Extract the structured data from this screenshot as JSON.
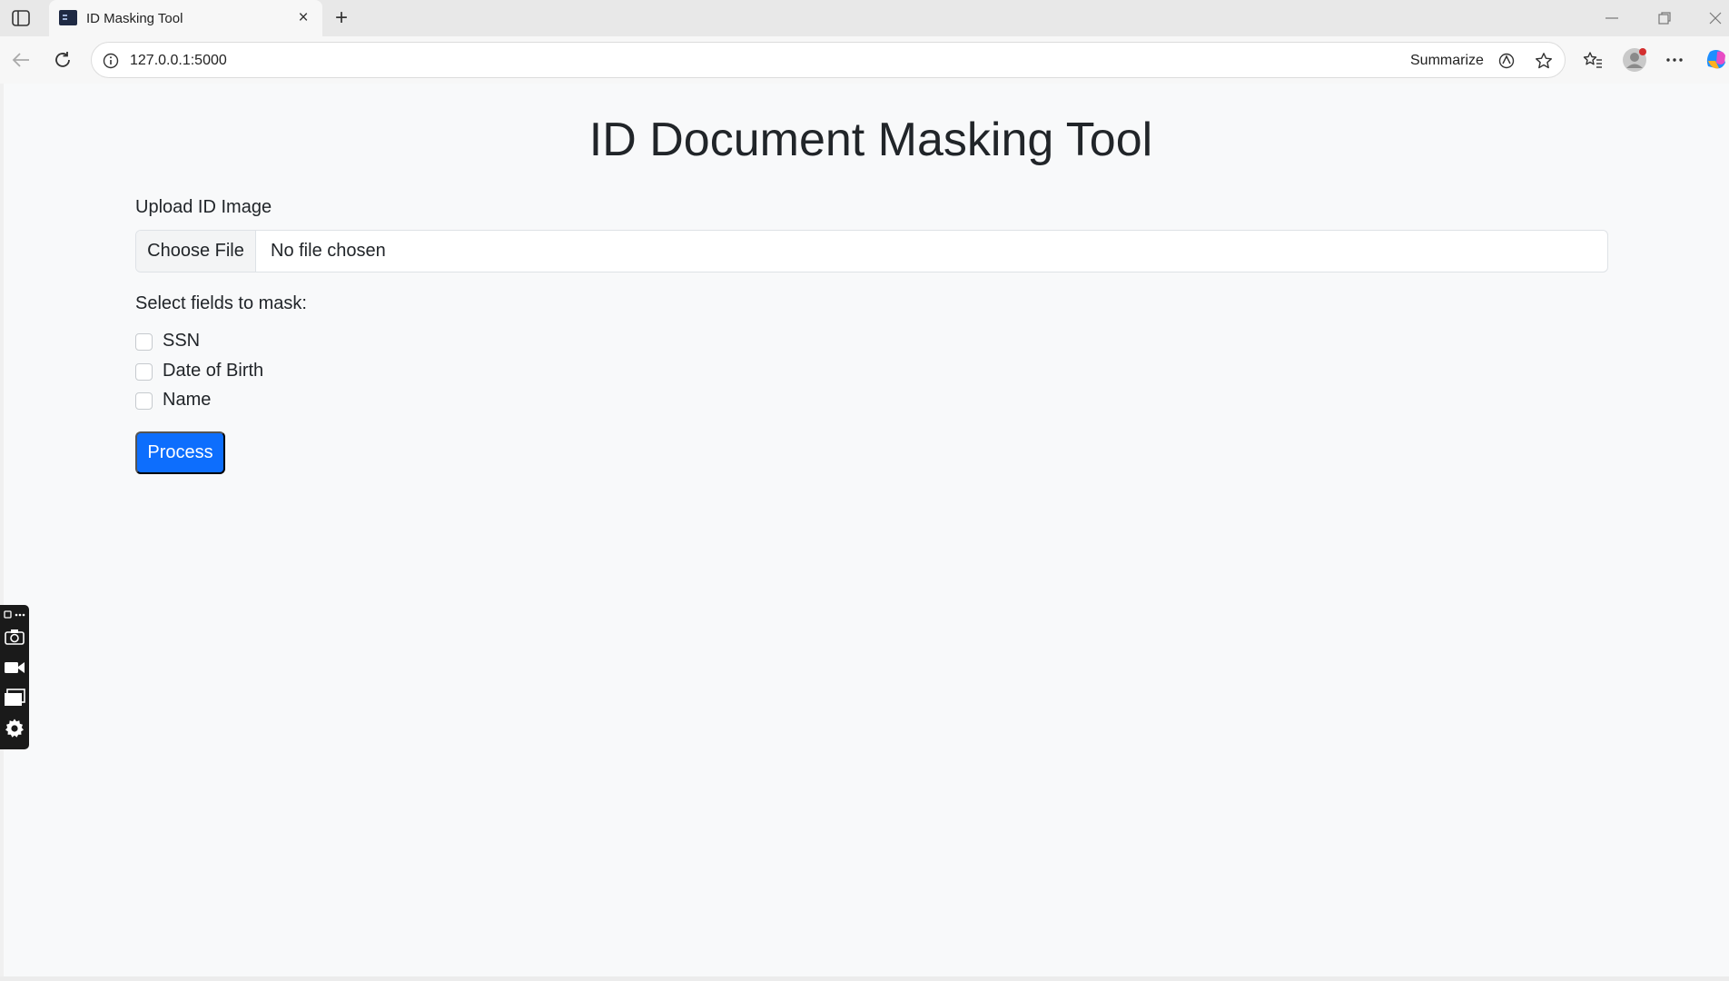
{
  "browser": {
    "tab": {
      "title": "ID Masking Tool"
    },
    "address_bar": {
      "url": "127.0.0.1:5000",
      "summarize_label": "Summarize"
    },
    "window_controls": [
      "minimize",
      "restore",
      "close"
    ]
  },
  "page": {
    "title": "ID Document Masking Tool",
    "upload": {
      "label": "Upload ID Image",
      "button_label": "Choose File",
      "status": "No file chosen"
    },
    "fields": {
      "label": "Select fields to mask:",
      "options": [
        {
          "label": "SSN",
          "checked": false
        },
        {
          "label": "Date of Birth",
          "checked": false
        },
        {
          "label": "Name",
          "checked": false
        }
      ]
    },
    "process_label": "Process"
  },
  "colors": {
    "primary": "#0d6efd",
    "page_background": "#f8f9fa",
    "text": "#212529"
  }
}
